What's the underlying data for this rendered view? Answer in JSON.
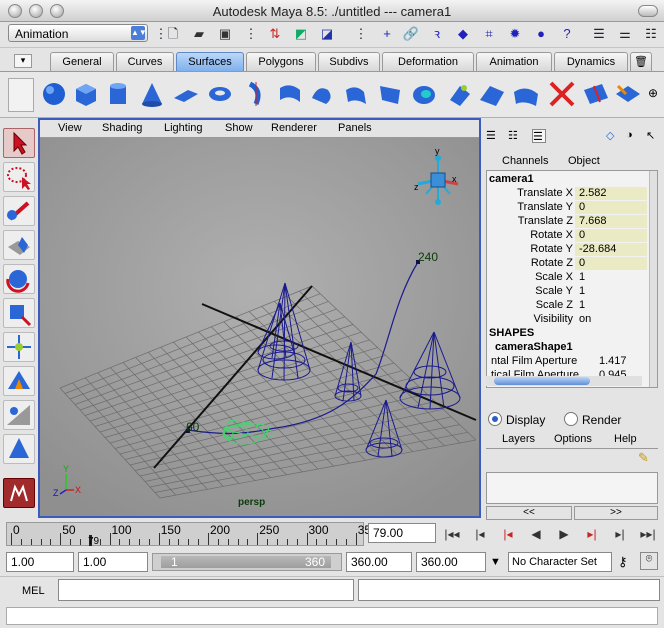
{
  "window": {
    "title": "Autodesk Maya 8.5: ./untitled    ---    camera1"
  },
  "status_line": {
    "mode_menu": "Animation"
  },
  "shelf": {
    "tabs": [
      "General",
      "Curves",
      "Surfaces",
      "Polygons",
      "Subdivs",
      "Deformation",
      "Animation",
      "Dynamics"
    ],
    "active_tab": "Surfaces",
    "icons": [
      "nurbs-sphere-icon",
      "nurbs-cube-icon",
      "nurbs-cylinder-icon",
      "nurbs-cone-icon",
      "nurbs-plane-icon",
      "nurbs-torus-icon",
      "revolve-icon",
      "loft-icon",
      "planar-icon",
      "extrude-icon",
      "birail-icon",
      "boundary-icon",
      "square-icon",
      "project-curve-icon",
      "intersect-icon",
      "trim-icon",
      "untrim-icon",
      "attach-icon",
      "detach-icon"
    ]
  },
  "viewport": {
    "menu": [
      "View",
      "Shading",
      "Lighting",
      "Show",
      "Renderer",
      "Panels"
    ],
    "camera_label": "persp",
    "path_start_label": "60",
    "path_end_label": "240",
    "axis_labels": {
      "x": "X",
      "y": "Y",
      "z": "Z"
    },
    "view_cube_labels": {
      "y": "y",
      "x": "x",
      "z": "z"
    }
  },
  "channel_box": {
    "tabs": [
      "Channels",
      "Object"
    ],
    "object_name": "camera1",
    "attributes": [
      {
        "name": "Translate X",
        "value": "2.582",
        "highlight": true
      },
      {
        "name": "Translate Y",
        "value": "0",
        "highlight": true
      },
      {
        "name": "Translate Z",
        "value": "7.668",
        "highlight": true
      },
      {
        "name": "Rotate X",
        "value": "0",
        "highlight": true
      },
      {
        "name": "Rotate Y",
        "value": "-28.684",
        "highlight": true
      },
      {
        "name": "Rotate Z",
        "value": "0",
        "highlight": true
      },
      {
        "name": "Scale X",
        "value": "1",
        "highlight": false
      },
      {
        "name": "Scale Y",
        "value": "1",
        "highlight": false
      },
      {
        "name": "Scale Z",
        "value": "1",
        "highlight": false
      },
      {
        "name": "Visibility",
        "value": "on",
        "highlight": false
      }
    ],
    "shapes_header": "SHAPES",
    "shape_name": "cameraShape1",
    "shape_attributes": [
      {
        "name": "ntal Film Aperture",
        "value": "1.417"
      },
      {
        "name": "tical Film Aperture",
        "value": "0.945"
      }
    ]
  },
  "layer_editor": {
    "radio_display": "Display",
    "radio_render": "Render",
    "selected": "Display",
    "menu": [
      "Layers",
      "Options",
      "Help"
    ],
    "nav_prev": "<<",
    "nav_next": ">>"
  },
  "time_slider": {
    "tick_labels": [
      "0",
      "50",
      "100",
      "150",
      "200",
      "250",
      "300",
      "35"
    ],
    "current_marker": "79",
    "current_time": "79.00"
  },
  "range_slider": {
    "start_time": "1.00",
    "playback_start": "1.00",
    "range_start_label": "1",
    "range_end_label": "360",
    "playback_end": "360.00",
    "end_time": "360.00",
    "character_set": "No Character Set"
  },
  "command_line": {
    "label": "MEL"
  },
  "colors": {
    "accent_blue": "#3b5bbd",
    "wire_blue": "#1a1a8c",
    "camera_green": "#3fd66a",
    "channel_highlight": "#eaeac4"
  }
}
